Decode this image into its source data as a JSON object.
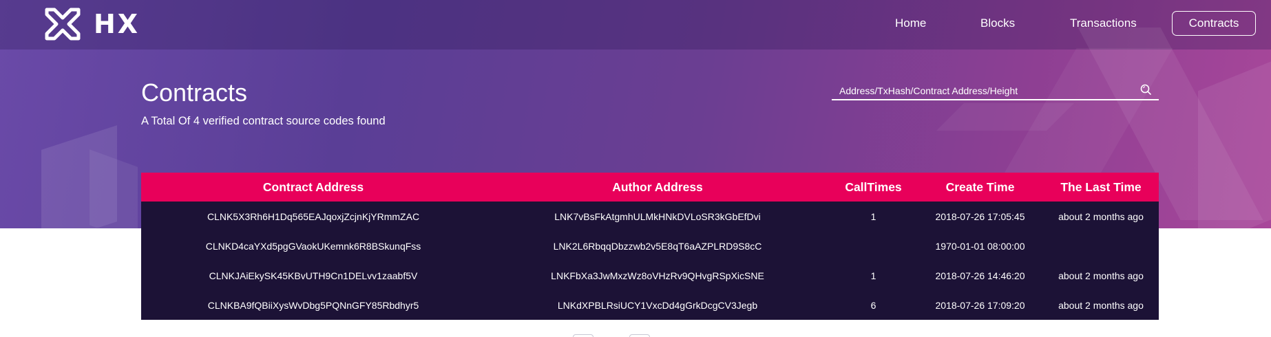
{
  "brand": {
    "name": "HX"
  },
  "nav": {
    "home": "Home",
    "blocks": "Blocks",
    "transactions": "Transactions",
    "contracts": "Contracts"
  },
  "header": {
    "title": "Contracts",
    "subtitle": "A Total Of 4 verified contract source codes found"
  },
  "search": {
    "placeholder": "Address/TxHash/Contract Address/Height",
    "icon": "search-icon"
  },
  "table": {
    "columns": [
      "Contract Address",
      "Author Address",
      "CallTimes",
      "Create Time",
      "The Last Time"
    ],
    "rows": [
      {
        "contract": "CLNK5X3Rh6H1Dq565EAJqoxjZcjnKjYRmmZAC",
        "author": "LNK7vBsFkAtgmhULMkHNkDVLoSR3kGbEfDvi",
        "calltimes": "1",
        "create": "2018-07-26 17:05:45",
        "last": "about 2 months ago"
      },
      {
        "contract": "CLNKD4caYXd5pgGVaokUKemnk6R8BSkunqFss",
        "author": "LNK2L6RbqqDbzzwb2v5E8qT6aAZPLRD9S8cC",
        "calltimes": "",
        "create": "1970-01-01 08:00:00",
        "last": ""
      },
      {
        "contract": "CLNKJAiEkySK45KBvUTH9Cn1DELvv1zaabf5V",
        "author": "LNKFbXa3JwMxzWz8oVHzRv9QHvgRSpXicSNE",
        "calltimes": "1",
        "create": "2018-07-26 14:46:20",
        "last": "about 2 months ago"
      },
      {
        "contract": "CLNKBA9fQBiiXysWvDbg5PQNnGFY85Rbdhyr5",
        "author": "LNKdXPBLRsiUCY1VxcDd4gGrkDcgCV3Jegb",
        "calltimes": "6",
        "create": "2018-07-26 17:09:20",
        "last": "about 2 months ago"
      }
    ]
  },
  "colors": {
    "header_bar": "#e8005a",
    "table_body": "#1c1236",
    "hero_start": "#6a4aa8",
    "hero_end": "#a8479a"
  }
}
